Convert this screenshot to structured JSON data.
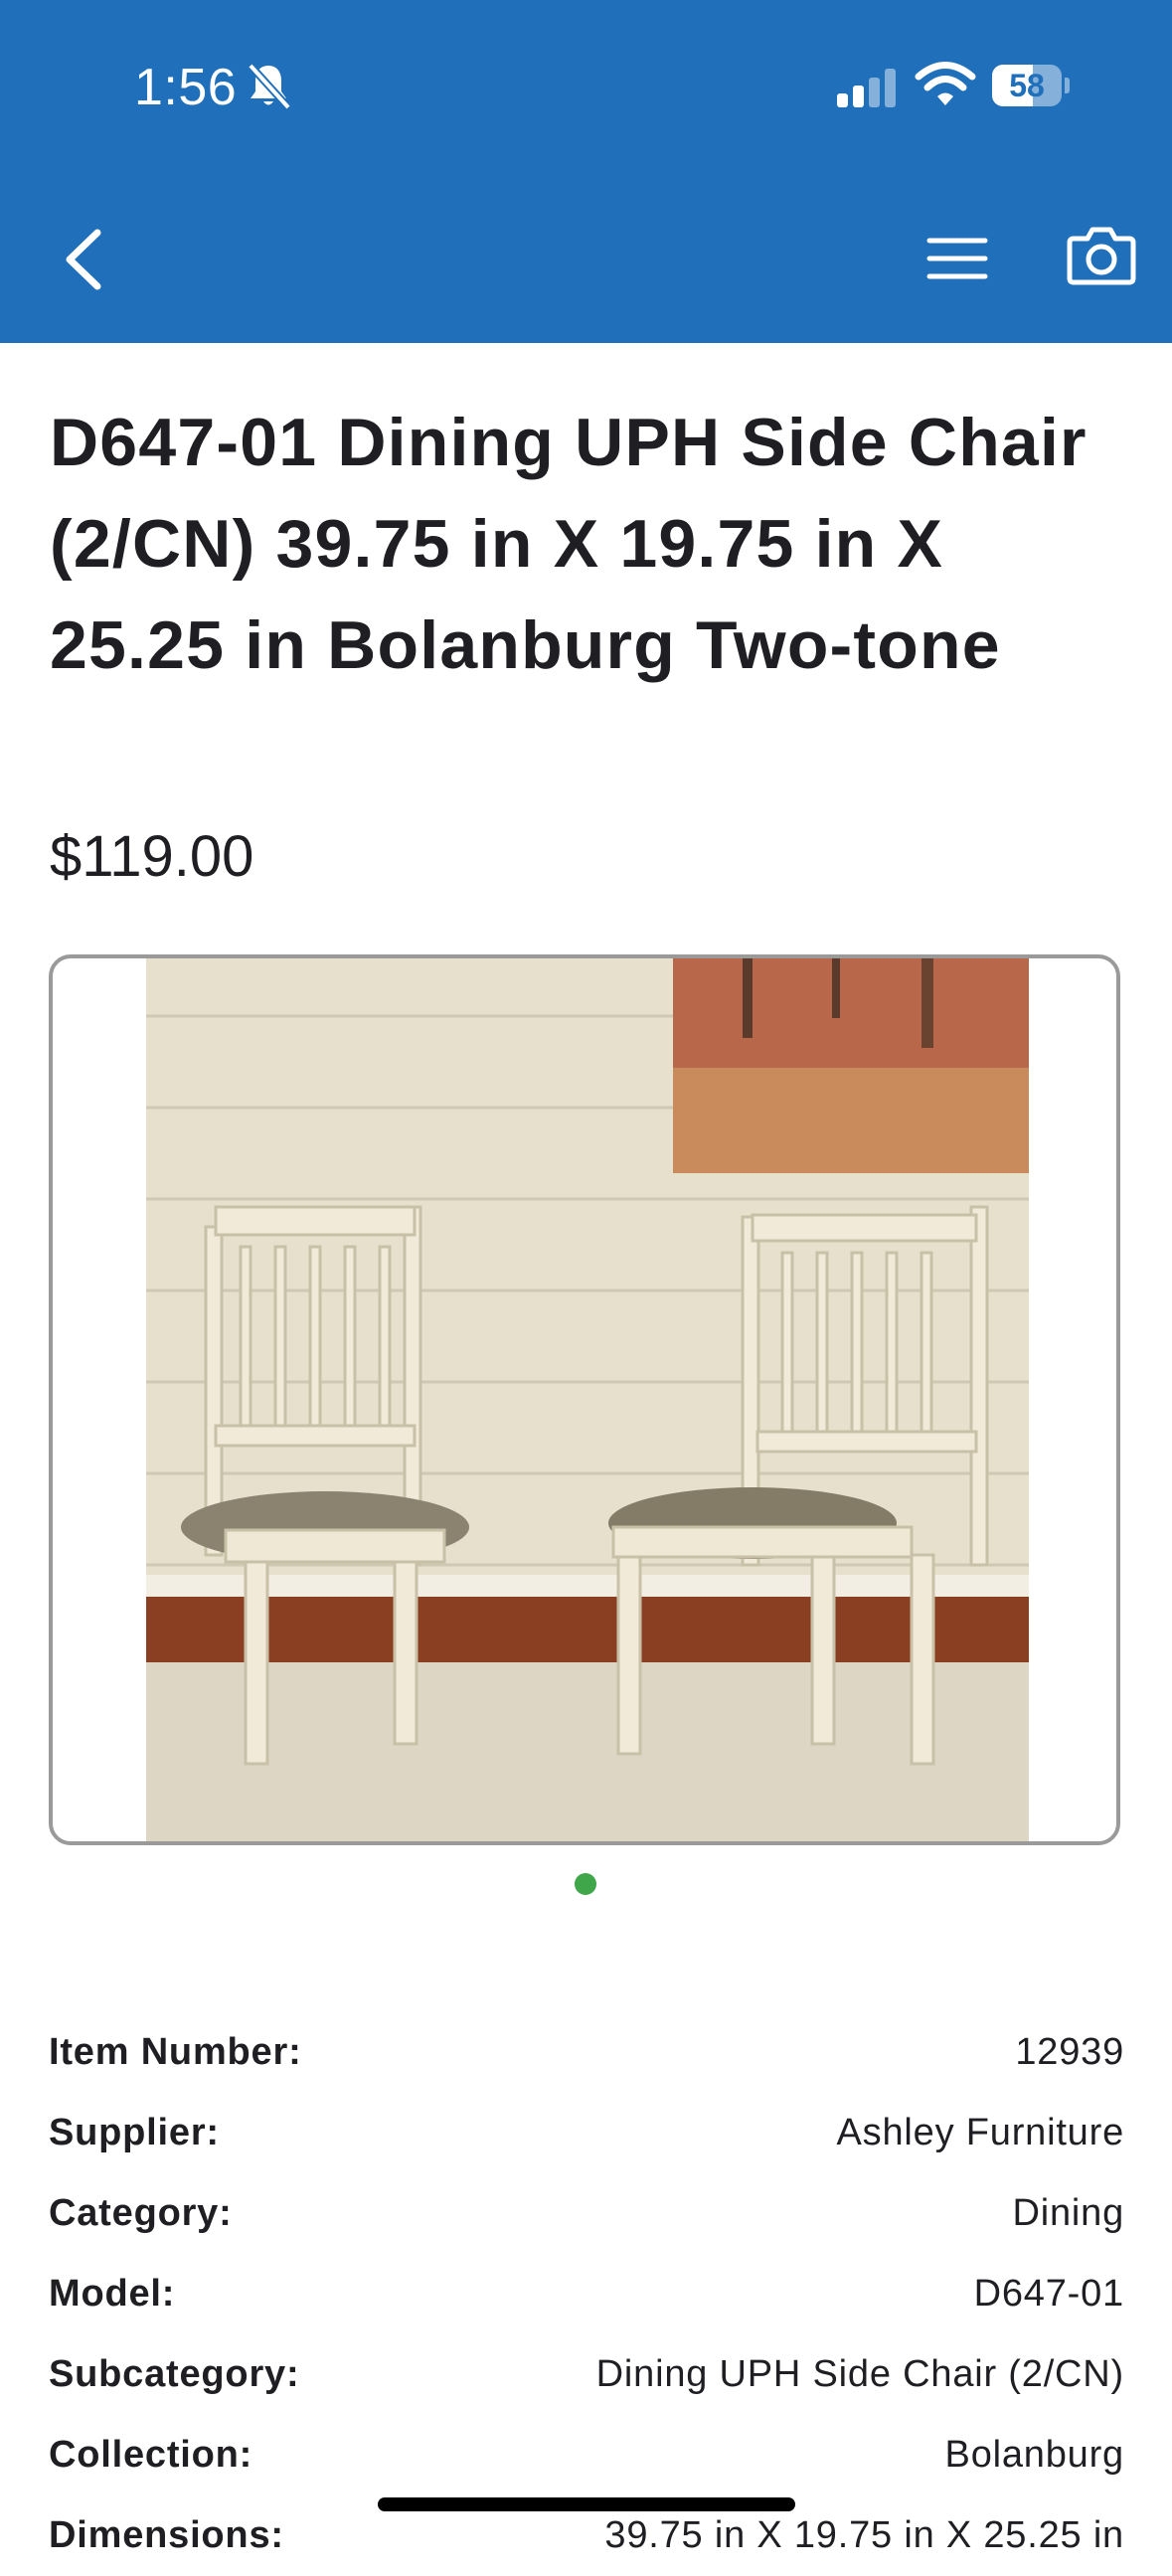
{
  "status_bar": {
    "time": "1:56",
    "battery": "58",
    "battery_level": 0.58,
    "icons": [
      "bell-slash-icon",
      "signal-icon",
      "wifi-icon",
      "battery-icon"
    ]
  },
  "nav": {
    "icons": [
      "chevron-left-icon",
      "hamburger-menu-icon",
      "camera-icon"
    ],
    "bar_color": "#1f6fbb"
  },
  "product": {
    "title": "D647-01 Dining UPH Side Chair (2/CN) 39.75 in X 19.75 in X 25.25 in Bolanburg Two-tone",
    "price": "$119.00"
  },
  "carousel": {
    "active_index": 0,
    "page_count": 1,
    "dot_color": "#3fa64a"
  },
  "specs": [
    {
      "label": "Item Number:",
      "value": "12939"
    },
    {
      "label": "Supplier:",
      "value": "Ashley Furniture"
    },
    {
      "label": "Category:",
      "value": "Dining"
    },
    {
      "label": "Model:",
      "value": "D647-01"
    },
    {
      "label": "Subcategory:",
      "value": "Dining UPH Side Chair (2/CN)"
    },
    {
      "label": "Collection:",
      "value": "Bolanburg"
    },
    {
      "label": "Dimensions:",
      "value": "39.75 in X 19.75 in X 25.25 in"
    }
  ]
}
